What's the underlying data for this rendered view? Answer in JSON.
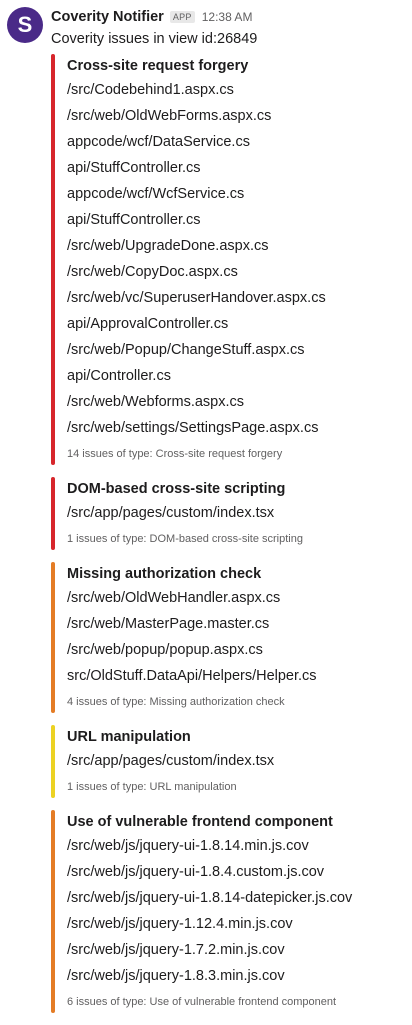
{
  "message": {
    "avatar_letter": "S",
    "sender": "Coverity Notifier",
    "badge": "APP",
    "time": "12:38 AM",
    "text": "Coverity issues in view id:26849",
    "colors": {
      "avatar": "#4a2a88",
      "red": "#d7262c",
      "orange": "#e47c25",
      "yellow": "#ecd223"
    }
  },
  "attachments": [
    {
      "title": "Cross-site request forgery",
      "color": "#d7262c",
      "files": [
        "/src/Codebehind1.aspx.cs",
        "/src/web/OldWebForms.aspx.cs",
        "appcode/wcf/DataService.cs",
        "api/StuffController.cs",
        "appcode/wcf/WcfService.cs",
        "api/StuffController.cs",
        "/src/web/UpgradeDone.aspx.cs",
        "/src/web/CopyDoc.aspx.cs",
        "/src/web/vc/SuperuserHandover.aspx.cs",
        "api/ApprovalController.cs",
        "/src/web/Popup/ChangeStuff.aspx.cs",
        "api/Controller.cs",
        "/src/web/Webforms.aspx.cs",
        "/src/web/settings/SettingsPage.aspx.cs"
      ],
      "footer": "14 issues of type: Cross-site request forgery"
    },
    {
      "title": "DOM-based cross-site scripting",
      "color": "#d7262c",
      "files": [
        "/src/app/pages/custom/index.tsx"
      ],
      "footer": "1 issues of type: DOM-based cross-site scripting"
    },
    {
      "title": "Missing authorization check",
      "color": "#e47c25",
      "files": [
        "/src/web/OldWebHandler.aspx.cs",
        "/src/web/MasterPage.master.cs",
        "/src/web/popup/popup.aspx.cs",
        "src/OldStuff.DataApi/Helpers/Helper.cs"
      ],
      "footer": "4 issues of type: Missing authorization check"
    },
    {
      "title": "URL manipulation",
      "color": "#ecd223",
      "files": [
        "/src/app/pages/custom/index.tsx"
      ],
      "footer": "1 issues of type: URL manipulation"
    },
    {
      "title": "Use of vulnerable frontend component",
      "color": "#e47c25",
      "files": [
        "/src/web/js/jquery-ui-1.8.14.min.js.cov",
        "/src/web/js/jquery-ui-1.8.4.custom.js.cov",
        "/src/web/js/jquery-ui-1.8.14-datepicker.js.cov",
        "/src/web/js/jquery-1.12.4.min.js.cov",
        "/src/web/js/jquery-1.7.2.min.js.cov",
        "/src/web/js/jquery-1.8.3.min.js.cov"
      ],
      "footer": "6 issues of type: Use of vulnerable frontend component"
    }
  ]
}
